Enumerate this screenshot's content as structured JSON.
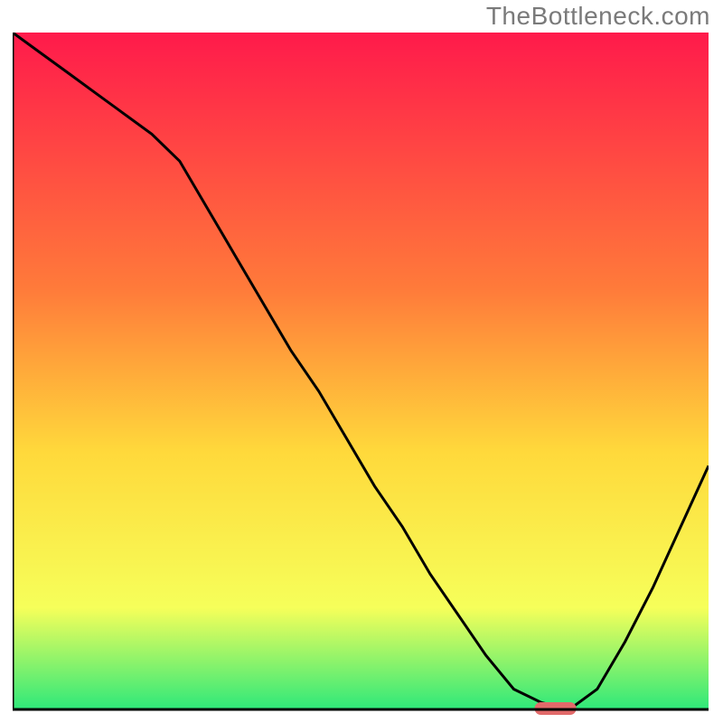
{
  "watermark": "TheBottleneck.com",
  "colors": {
    "curve": "#000000",
    "marker": "#e26a6a",
    "axis": "#000000",
    "grad_top": "#ff1a4b",
    "grad_mid1": "#ff7b3a",
    "grad_mid2": "#ffd93b",
    "grad_mid3": "#f6ff5a",
    "grad_bot": "#2ee87a"
  },
  "chart_data": {
    "type": "line",
    "title": "",
    "xlabel": "",
    "ylabel": "",
    "xlim": [
      0,
      100
    ],
    "ylim": [
      0,
      100
    ],
    "x": [
      0,
      4,
      8,
      12,
      16,
      20,
      24,
      28,
      32,
      36,
      40,
      44,
      48,
      52,
      56,
      60,
      64,
      68,
      72,
      76,
      80,
      84,
      88,
      92,
      96,
      100
    ],
    "values": [
      100,
      97,
      94,
      91,
      88,
      85,
      81,
      74,
      67,
      60,
      53,
      47,
      40,
      33,
      27,
      20,
      14,
      8,
      3,
      1,
      0,
      3,
      10,
      18,
      27,
      36
    ],
    "series": [
      {
        "name": "bottleneck",
        "values": [
          100,
          97,
          94,
          91,
          88,
          85,
          81,
          74,
          67,
          60,
          53,
          47,
          40,
          33,
          27,
          20,
          14,
          8,
          3,
          1,
          0,
          3,
          10,
          18,
          27,
          36
        ]
      }
    ],
    "marker": {
      "x": 78,
      "y": 0,
      "w": 6,
      "h": 2
    },
    "note": "x/y in percent of plot area; y=0 at bottom baseline, y=100 at top. Values read from pixel positions — approximate."
  }
}
